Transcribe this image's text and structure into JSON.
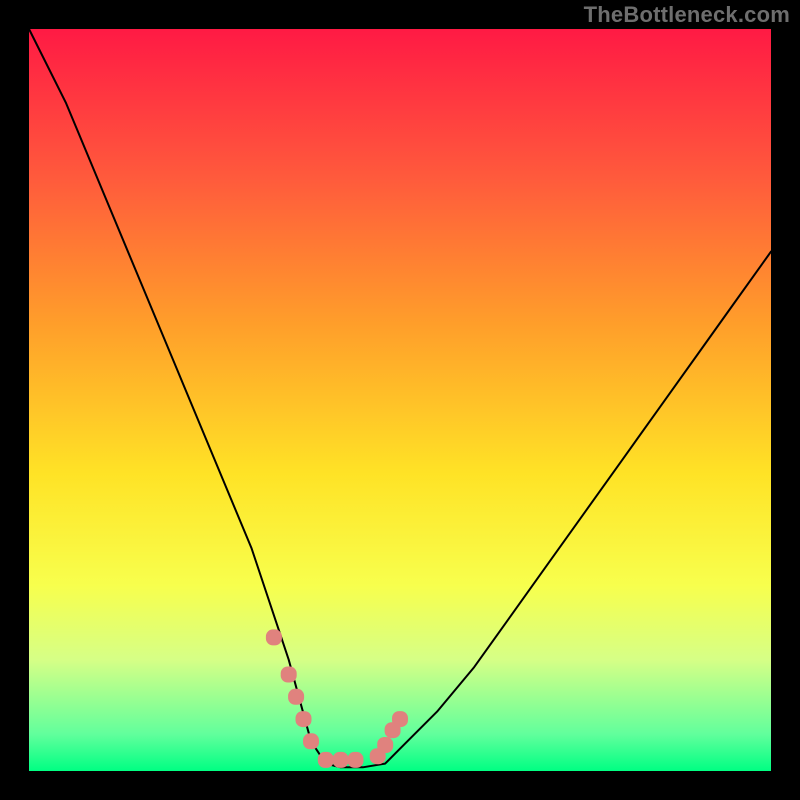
{
  "watermark": "TheBottleneck.com",
  "colors": {
    "background": "#000000",
    "gradient_top": "#ff1a44",
    "gradient_mid1": "#ff9f2a",
    "gradient_mid2": "#ffe326",
    "gradient_bottom": "#00ff83",
    "curve": "#000000",
    "marker": "#e0827e"
  },
  "chart_data": {
    "type": "line",
    "title": "",
    "xlabel": "",
    "ylabel": "",
    "xlim": [
      0,
      100
    ],
    "ylim": [
      0,
      100
    ],
    "series": [
      {
        "name": "bottleneck-curve",
        "x": [
          0,
          5,
          10,
          15,
          20,
          25,
          30,
          35,
          38,
          40,
          42,
          45,
          48,
          50,
          55,
          60,
          65,
          70,
          75,
          80,
          85,
          90,
          95,
          100
        ],
        "y": [
          100,
          90,
          78,
          66,
          54,
          42,
          30,
          15,
          4,
          1,
          0.5,
          0.5,
          1,
          3,
          8,
          14,
          21,
          28,
          35,
          42,
          49,
          56,
          63,
          70
        ]
      },
      {
        "name": "highlight-markers",
        "x": [
          33,
          35,
          36,
          37,
          38,
          40,
          42,
          44,
          47,
          48,
          49,
          50
        ],
        "y": [
          18,
          13,
          10,
          7,
          4,
          1.5,
          1.5,
          1.5,
          2,
          3.5,
          5.5,
          7
        ]
      }
    ]
  }
}
